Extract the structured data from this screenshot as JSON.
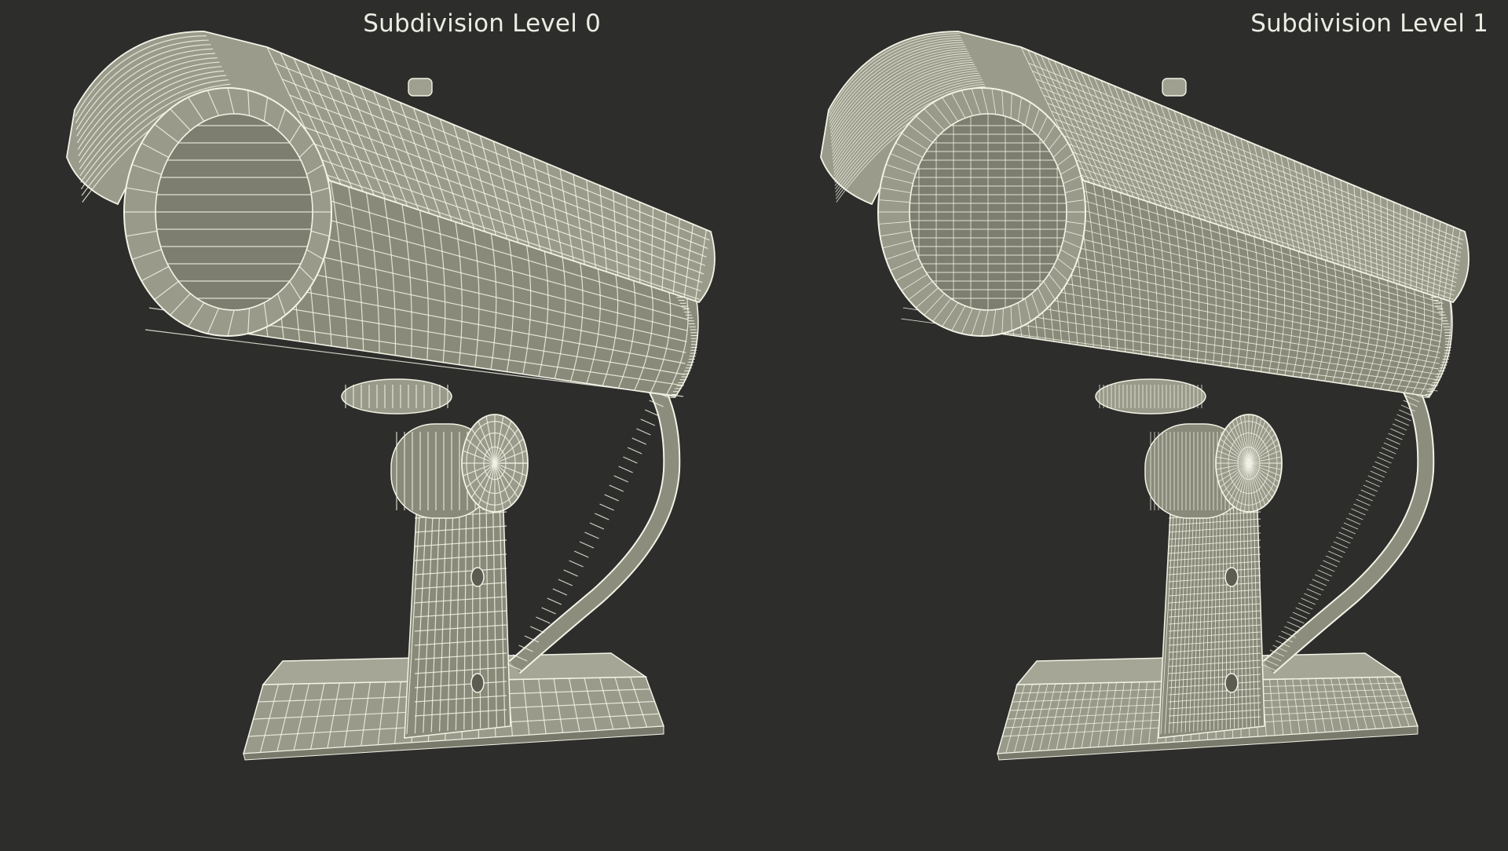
{
  "panels": [
    {
      "label": "Subdivision Level 0"
    },
    {
      "label": "Subdivision Level 1"
    }
  ],
  "colors": {
    "background": "#2d2d2b",
    "surface": "#8a8a7a",
    "wire": "#f2f2e6"
  },
  "subject": "security-camera-wireframe"
}
